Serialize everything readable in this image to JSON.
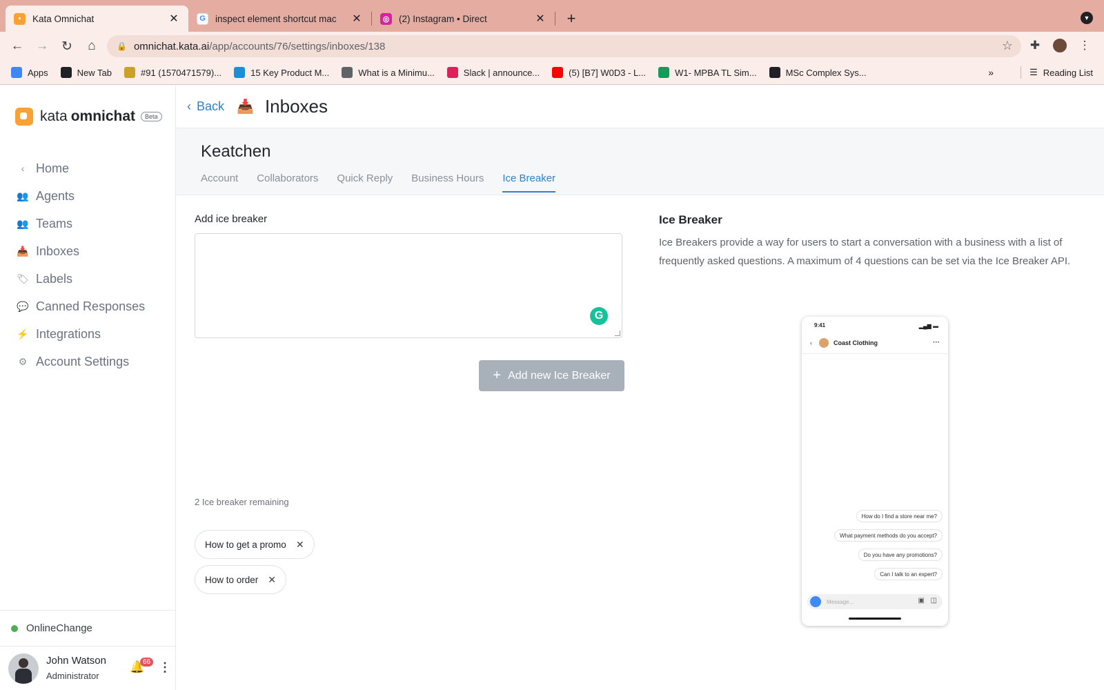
{
  "browser": {
    "tabs": [
      {
        "title": "Kata Omnichat",
        "favicon_color": "#f9a134",
        "active": true
      },
      {
        "title": "inspect element shortcut mac",
        "favicon_color": "#4285f4",
        "active": false
      },
      {
        "title": "(2) Instagram • Direct",
        "favicon_color": "#d6249f",
        "active": false
      }
    ],
    "url_host": "omnichat.kata.ai",
    "url_path": "/app/accounts/76/settings/inboxes/138",
    "bookmarks": [
      {
        "label": "Apps",
        "icon": "apps-grid-icon",
        "color": "#4285f4"
      },
      {
        "label": "New Tab",
        "icon": "new-tab-icon",
        "color": "#202124"
      },
      {
        "label": "#91 (1570471579)...",
        "icon": "bookmark-icon",
        "color": "#c9a227"
      },
      {
        "label": "15 Key Product M...",
        "icon": "bookmark-icon",
        "color": "#1a8fd8"
      },
      {
        "label": "What is a Minimu...",
        "icon": "bookmark-icon",
        "color": "#5f6368"
      },
      {
        "label": "Slack | announce...",
        "icon": "slack-icon",
        "color": "#e01e5a"
      },
      {
        "label": "(5) [B7] W0D3 - L...",
        "icon": "youtube-icon",
        "color": "#ff0000"
      },
      {
        "label": "W1- MPBA TL Sim...",
        "icon": "sheets-icon",
        "color": "#0f9d58"
      },
      {
        "label": "MSc Complex Sys...",
        "icon": "bookmark-icon",
        "color": "#202124"
      }
    ],
    "more_bookmarks": "»",
    "reading_list": "Reading List"
  },
  "app": {
    "logo_kata": "kata",
    "logo_omnichat": "omnichat",
    "logo_beta": "Beta",
    "nav": [
      {
        "label": "Home",
        "icon": "chevron-left-icon",
        "glyph": "‹"
      },
      {
        "label": "Agents",
        "icon": "agents-icon",
        "glyph": "👥"
      },
      {
        "label": "Teams",
        "icon": "teams-icon",
        "glyph": "👥"
      },
      {
        "label": "Inboxes",
        "icon": "inbox-icon",
        "glyph": "📥"
      },
      {
        "label": "Labels",
        "icon": "label-icon",
        "glyph": "🏷"
      },
      {
        "label": "Canned Responses",
        "icon": "canned-responses-icon",
        "glyph": "💬"
      },
      {
        "label": "Integrations",
        "icon": "integrations-icon",
        "glyph": "⚡"
      },
      {
        "label": "Account Settings",
        "icon": "gear-icon",
        "glyph": "⚙"
      }
    ],
    "status": "Online",
    "status_change": "Change",
    "user_name": "John Watson",
    "user_role": "Administrator",
    "notification_count": "66"
  },
  "main": {
    "back_label": "Back",
    "page_title": "Inboxes",
    "inbox_name": "Keatchen",
    "tabs": [
      "Account",
      "Collaborators",
      "Quick Reply",
      "Business Hours",
      "Ice Breaker"
    ],
    "active_tab": "Ice Breaker",
    "add_label": "Add ice breaker",
    "textarea_value": "",
    "add_button": "Add new Ice Breaker",
    "remaining": "2 Ice breaker remaining",
    "chips": [
      "How to get a promo",
      "How to order"
    ],
    "info_title": "Ice Breaker",
    "info_desc": "Ice Breakers provide a way for users to start a conversation with a business with a list of frequently asked questions. A maximum of 4 questions can be set via the Ice Breaker API."
  },
  "phone": {
    "time": "9:41",
    "contact": "Coast Clothing",
    "questions": [
      "How do I find a store near me?",
      "What payment methods do you accept?",
      "Do you have any promotions?",
      "Can I talk to an expert?"
    ],
    "input_placeholder": "Message..."
  },
  "colors": {
    "accent": "#2f80c8",
    "button_disabled": "#a8b0ba",
    "online": "#4caf50",
    "tabstrip": "#e5ada2"
  }
}
